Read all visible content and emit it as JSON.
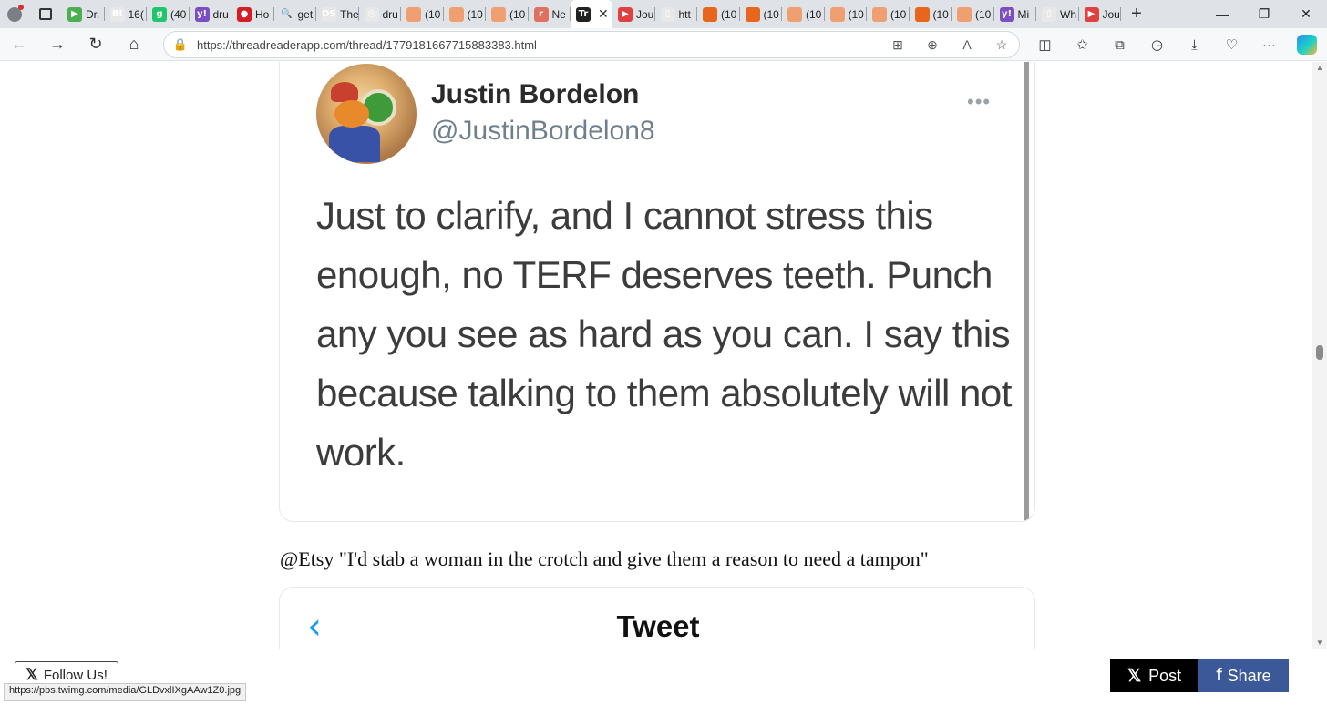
{
  "browser": {
    "tabs": [
      {
        "label": "Dr.",
        "fav_color": "#4caf50",
        "fav_glyph": "▶"
      },
      {
        "label": "16(",
        "fav_color": "#e8e8e8",
        "fav_glyph": "BI"
      },
      {
        "label": "(40",
        "fav_color": "#1fc76a",
        "fav_glyph": "g"
      },
      {
        "label": "dru",
        "fav_color": "#7b4fc2",
        "fav_glyph": "y!"
      },
      {
        "label": "Ho",
        "fav_color": "#d71d24",
        "fav_glyph": "●"
      },
      {
        "label": "get",
        "fav_color": "#dfe3e8",
        "fav_glyph": "🔍"
      },
      {
        "label": "The",
        "fav_color": "#e8e8e8",
        "fav_glyph": "DS"
      },
      {
        "label": "dru",
        "fav_color": "#e8e8e8",
        "fav_glyph": "◎"
      },
      {
        "label": "(10",
        "fav_color": "#f0a070",
        "fav_glyph": ""
      },
      {
        "label": "(10",
        "fav_color": "#f0a070",
        "fav_glyph": ""
      },
      {
        "label": "(10",
        "fav_color": "#f0a070",
        "fav_glyph": ""
      },
      {
        "label": "Ne",
        "fav_color": "#e07060",
        "fav_glyph": "r"
      },
      {
        "label": "",
        "fav_color": "#222222",
        "fav_glyph": "Tr",
        "active": true
      },
      {
        "label": "Jou",
        "fav_color": "#e04040",
        "fav_glyph": "▶"
      },
      {
        "label": "htt",
        "fav_color": "#e8e8e8",
        "fav_glyph": "▯"
      },
      {
        "label": "(10",
        "fav_color": "#e8661c",
        "fav_glyph": ""
      },
      {
        "label": "(10",
        "fav_color": "#e8661c",
        "fav_glyph": ""
      },
      {
        "label": "(10",
        "fav_color": "#f0a070",
        "fav_glyph": ""
      },
      {
        "label": "(10",
        "fav_color": "#f0a070",
        "fav_glyph": ""
      },
      {
        "label": "(10",
        "fav_color": "#f0a070",
        "fav_glyph": ""
      },
      {
        "label": "(10",
        "fav_color": "#e8661c",
        "fav_glyph": ""
      },
      {
        "label": "(10",
        "fav_color": "#f0a070",
        "fav_glyph": ""
      },
      {
        "label": "Mi",
        "fav_color": "#7b4fc2",
        "fav_glyph": "y!"
      },
      {
        "label": "Wh",
        "fav_color": "#e8e8e8",
        "fav_glyph": "▯"
      },
      {
        "label": "Jou",
        "fav_color": "#e04040",
        "fav_glyph": "▶"
      }
    ],
    "url": "https://threadreaderapp.com/thread/1779181667715883383.html"
  },
  "tweet1": {
    "name": "Justin Bordelon",
    "handle": "@JustinBordelon8",
    "text": "Just to clarify, and I cannot stress this enough, no TERF deserves teeth. Punch any you see as hard as you can. I say this because talking to them absolutely will not work."
  },
  "caption": "@Etsy \"I'd stab a woman in the crotch and give them a reason to need a tampon\"",
  "tweet2": {
    "header": "Tweet"
  },
  "footer": {
    "follow_label": "Follow Us!",
    "post_label": "Post",
    "share_label": "Share"
  },
  "status_url": "https://pbs.twimg.com/media/GLDvxlIXgAAw1Z0.jpg",
  "colors": {
    "facebook": "#3b5998",
    "twitter_blue": "#1d9bf0"
  }
}
